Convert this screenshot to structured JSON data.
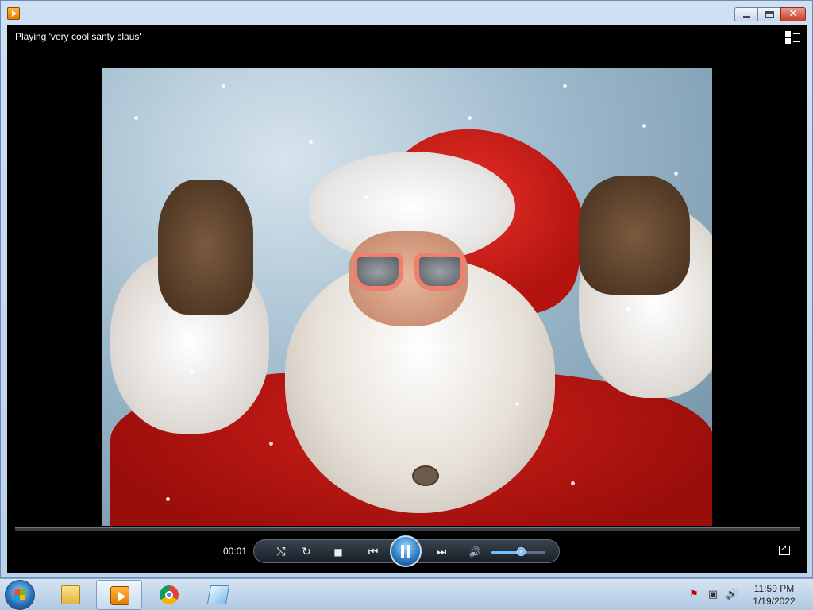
{
  "window": {
    "icon": "media-player-icon",
    "controls": [
      "minimize-icon",
      "maximize-icon",
      "close-icon"
    ],
    "close_glyph": "✕"
  },
  "player": {
    "now_playing": "Playing 'very cool santy claus'",
    "switch_to_library_icon": "switch-to-library-icon",
    "video_subject": "santa-claus-rock-on-image",
    "time": "00:01",
    "volume_level_percent": 55
  },
  "controls": {
    "shuffle_glyph": "⤭",
    "repeat_glyph": "↻",
    "stop_glyph": "■",
    "prev_glyph": "⏮",
    "next_glyph": "⏭",
    "mute_glyph": "🔊"
  },
  "taskbar": {
    "apps": [
      "file-explorer-icon",
      "windows-media-player-icon",
      "chrome-icon",
      "notepad-icon"
    ],
    "tray": {
      "flag_glyph": "⚑",
      "network_glyph": "▣",
      "volume_glyph": "🔊"
    },
    "clock": {
      "time": "11:59 PM",
      "date": "1/19/2022"
    }
  }
}
